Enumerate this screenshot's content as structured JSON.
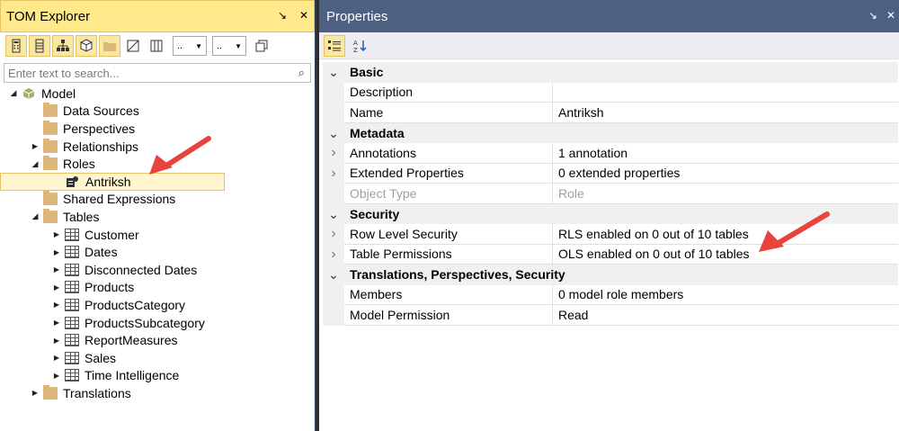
{
  "tom": {
    "title": "TOM Explorer",
    "pin": "↘",
    "close": "✕",
    "dropdown1": "..",
    "dropdown2": "..",
    "search_placeholder": "Enter text to search...",
    "tree": [
      {
        "label": "Model",
        "depth": 0,
        "expander": "expanded",
        "icon": "model"
      },
      {
        "label": "Data Sources",
        "depth": 1,
        "expander": "",
        "icon": "folder"
      },
      {
        "label": "Perspectives",
        "depth": 1,
        "expander": "",
        "icon": "folder"
      },
      {
        "label": "Relationships",
        "depth": 1,
        "expander": "collapsed",
        "icon": "folder"
      },
      {
        "label": "Roles",
        "depth": 1,
        "expander": "expanded",
        "icon": "folder"
      },
      {
        "label": "Antriksh",
        "depth": 2,
        "expander": "",
        "icon": "role",
        "selected": true
      },
      {
        "label": "Shared Expressions",
        "depth": 1,
        "expander": "",
        "icon": "folder"
      },
      {
        "label": "Tables",
        "depth": 1,
        "expander": "expanded",
        "icon": "folder"
      },
      {
        "label": "Customer",
        "depth": 2,
        "expander": "collapsed",
        "icon": "table"
      },
      {
        "label": "Dates",
        "depth": 2,
        "expander": "collapsed",
        "icon": "table"
      },
      {
        "label": "Disconnected Dates",
        "depth": 2,
        "expander": "collapsed",
        "icon": "calc-table"
      },
      {
        "label": "Products",
        "depth": 2,
        "expander": "collapsed",
        "icon": "table"
      },
      {
        "label": "ProductsCategory",
        "depth": 2,
        "expander": "collapsed",
        "icon": "table"
      },
      {
        "label": "ProductsSubcategory",
        "depth": 2,
        "expander": "collapsed",
        "icon": "table"
      },
      {
        "label": "ReportMeasures",
        "depth": 2,
        "expander": "collapsed",
        "icon": "table"
      },
      {
        "label": "Sales",
        "depth": 2,
        "expander": "collapsed",
        "icon": "table"
      },
      {
        "label": "Time Intelligence",
        "depth": 2,
        "expander": "collapsed",
        "icon": "calc-group"
      },
      {
        "label": "Translations",
        "depth": 1,
        "expander": "collapsed",
        "icon": "folder"
      }
    ]
  },
  "props": {
    "title": "Properties",
    "pin": "↘",
    "close": "✕",
    "rows": [
      {
        "kind": "category",
        "label": "Basic"
      },
      {
        "kind": "prop",
        "name": "Description",
        "value": ""
      },
      {
        "kind": "prop",
        "name": "Name",
        "value": "Antriksh"
      },
      {
        "kind": "category",
        "label": "Metadata"
      },
      {
        "kind": "prop",
        "name": "Annotations",
        "value": "1 annotation",
        "expandable": true
      },
      {
        "kind": "prop",
        "name": "Extended Properties",
        "value": "0 extended properties",
        "expandable": true
      },
      {
        "kind": "prop",
        "name": "Object Type",
        "value": "Role",
        "disabled": true
      },
      {
        "kind": "category",
        "label": "Security"
      },
      {
        "kind": "prop",
        "name": "Row Level Security",
        "value": "RLS enabled on 0 out of 10 tables",
        "expandable": true
      },
      {
        "kind": "prop",
        "name": "Table Permissions",
        "value": "OLS enabled on 0 out of 10 tables",
        "expandable": true
      },
      {
        "kind": "category",
        "label": "Translations, Perspectives, Security"
      },
      {
        "kind": "prop",
        "name": "Members",
        "value": "0 model role members"
      },
      {
        "kind": "prop",
        "name": "Model Permission",
        "value": "Read"
      }
    ]
  },
  "colors": {
    "tom_title_bg": "#ffe98a",
    "props_title_bg": "#4d6082",
    "folder": "#dcb67a",
    "annotation_arrow": "#e8433c"
  }
}
